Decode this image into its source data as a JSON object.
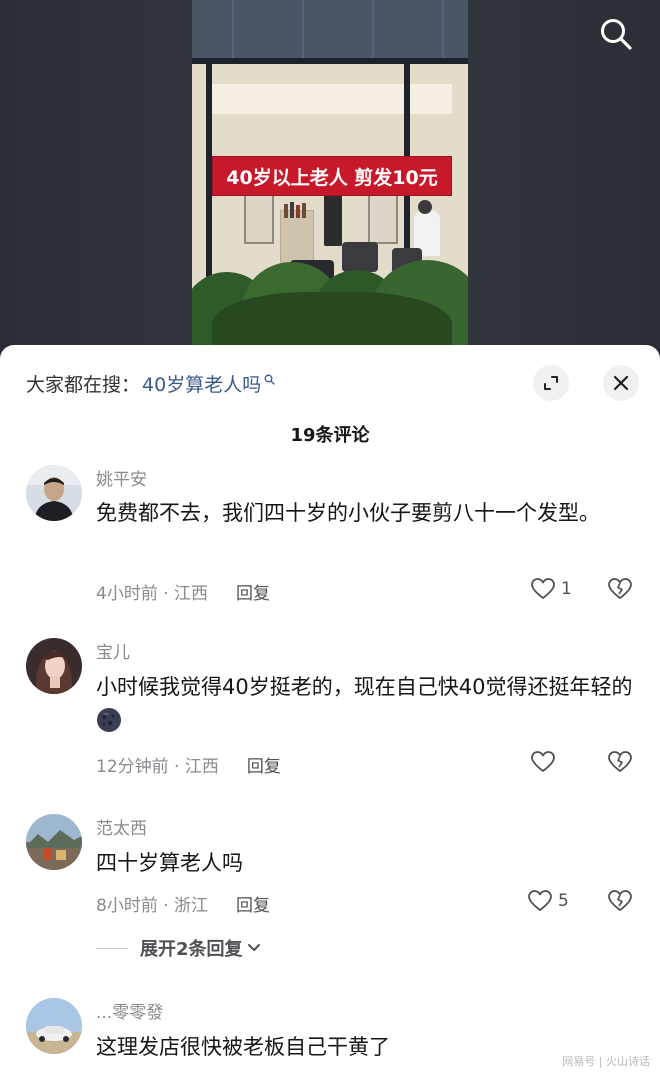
{
  "video": {
    "banner_text": "40岁以上老人 剪发10元"
  },
  "header": {
    "search_icon": "search-icon"
  },
  "sheet": {
    "suggest_prefix": "大家都在搜：",
    "suggest_query": "40岁算老人吗",
    "expand_icon": "expand-icon",
    "close_icon": "close-icon",
    "comment_count_title": "19条评论"
  },
  "comments": [
    {
      "user": "姚平安",
      "text": "免费都不去，我们四十岁的小伙子要剪八十一个发型。",
      "time_loc": "4小时前 · 江西",
      "reply_label": "回复",
      "likes": "1"
    },
    {
      "user": "宝儿",
      "text": "小时候我觉得40岁挺老的，现在自己快40觉得还挺年轻的",
      "emoji": "moon-face-emoji",
      "time_loc": "12分钟前 · 江西",
      "reply_label": "回复",
      "likes": ""
    },
    {
      "user": "范太西",
      "text": "四十岁算老人吗",
      "time_loc": "8小时前 · 浙江",
      "reply_label": "回复",
      "likes": "5"
    },
    {
      "user": "...零零發",
      "text": "这理发店很快被老板自己干黄了"
    }
  ],
  "expand_replies": {
    "label": "展开2条回复"
  },
  "watermark": "网易号 | 火山诗话",
  "colors": {
    "banner_red": "#c7192a",
    "link_blue": "#3a5a8c",
    "muted_gray": "#8a8a8f"
  }
}
